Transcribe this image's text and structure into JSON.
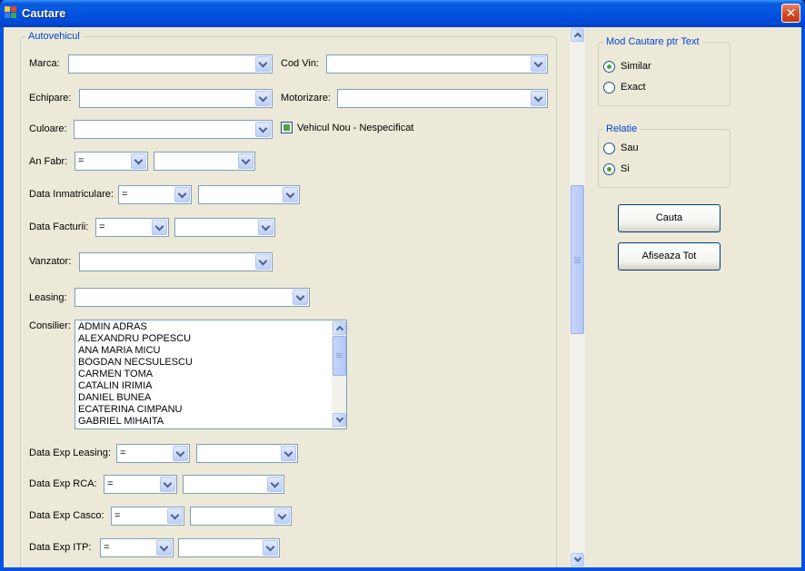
{
  "window": {
    "title": "Cautare"
  },
  "autovehicul": {
    "legend": "Autovehicul",
    "marca_label": "Marca:",
    "cod_vin_label": "Cod Vin:",
    "echipare_label": "Echipare:",
    "motorizare_label": "Motorizare:",
    "culoare_label": "Culoare:",
    "vehicul_nou_label": "Vehicul Nou - Nespecificat",
    "an_fabr_label": "An Fabr:",
    "an_fabr_op": "=",
    "data_inmatriculare_label": "Data Inmatriculare:",
    "data_inmatriculare_op": "=",
    "data_facturii_label": "Data Facturii:",
    "data_facturii_op": "=",
    "vanzator_label": "Vanzator:",
    "leasing_label": "Leasing:",
    "consilier_label": "Consilier:",
    "consilieri": [
      "ADMIN ADRAS",
      "ALEXANDRU POPESCU",
      "ANA MARIA MICU",
      "BOGDAN NECSULESCU",
      "CARMEN TOMA",
      "CATALIN IRIMIA",
      "DANIEL BUNEA",
      "ECATERINA CIMPANU",
      "GABRIEL MIHAITA"
    ],
    "data_exp_leasing_label": "Data Exp Leasing:",
    "data_exp_leasing_op": "=",
    "data_exp_rca_label": "Data Exp RCA:",
    "data_exp_rca_op": "=",
    "data_exp_casco_label": "Data Exp Casco:",
    "data_exp_casco_op": "=",
    "data_exp_itp_label": "Data Exp ITP:",
    "data_exp_itp_op": "="
  },
  "mod_cautare": {
    "legend": "Mod Cautare ptr Text",
    "similar_label": "Similar",
    "exact_label": "Exact",
    "selected": "Similar"
  },
  "relatie": {
    "legend": "Relatie",
    "sau_label": "Sau",
    "si_label": "Si",
    "selected": "Si"
  },
  "buttons": {
    "cauta": "Cauta",
    "afiseaza_tot": "Afiseaza Tot"
  },
  "colors": {
    "title_bar": "#0054e3",
    "legend_text": "#0046d5",
    "window_bg": "#ece9d8",
    "radio_check": "#49a63a"
  }
}
